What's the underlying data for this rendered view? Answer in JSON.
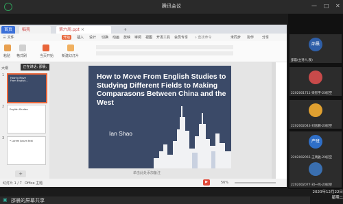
{
  "meeting": {
    "title": "腾讯会议",
    "sharing_label": "正在讲话: 邵晨;",
    "bottom_text": "邵晨的屏幕共享"
  },
  "tabs": {
    "home": "首页",
    "doc": "稻壳",
    "ppt": "第六周.ppt",
    "plus": "+"
  },
  "menu": {
    "file": "三 文件",
    "start": "开始",
    "insert": "插入",
    "design": "设计",
    "transitions": "切换",
    "animation": "动画",
    "slideshow": "放映",
    "review": "审阅",
    "view": "视图",
    "dev": "开发工具",
    "member": "会员专享",
    "search": "查找命令",
    "sync": "未同步",
    "collab": "协作",
    "share": "分享"
  },
  "ribbon": {
    "paste": "粘贴",
    "format_painter": "格式刷",
    "current_start": "当页开始",
    "new_slide": "新建幻灯片"
  },
  "slide": {
    "title": "How to Move From English Studies to Studying Different Fields to Making Comparasons Between China and the West",
    "author": "Ian Shao"
  },
  "thumbs": [
    {
      "num": "1",
      "title": "How to Move From English..."
    },
    {
      "num": "2",
      "title": "English Studies"
    },
    {
      "num": "3",
      "title": "• Lorem ipsum text"
    }
  ],
  "add_note": "单击此处添加备注",
  "status": {
    "slide_count": "幻灯片 1 / 7",
    "theme": "Office 主题",
    "zoom": "56%"
  },
  "participants": [
    {
      "avatar": "邵晨",
      "name": "邵晨(主持人,我)",
      "color": "#2f5fa8"
    },
    {
      "avatar": "",
      "name": "2202001711-梁智宇-20航空",
      "color": "#c84a4a"
    },
    {
      "avatar": "",
      "name": "2202002043-刘志鹏-20航空",
      "color": "#e0a030"
    },
    {
      "avatar": "产班",
      "name": "2202002055-王晓雅-20航空",
      "color": "#2f6fc8"
    },
    {
      "avatar": "",
      "name": "2202002077-刘一鸣-20航空",
      "color": "#3a6fb0"
    }
  ],
  "clock": {
    "date": "2020年12月22日",
    "weekday": "星期二"
  }
}
